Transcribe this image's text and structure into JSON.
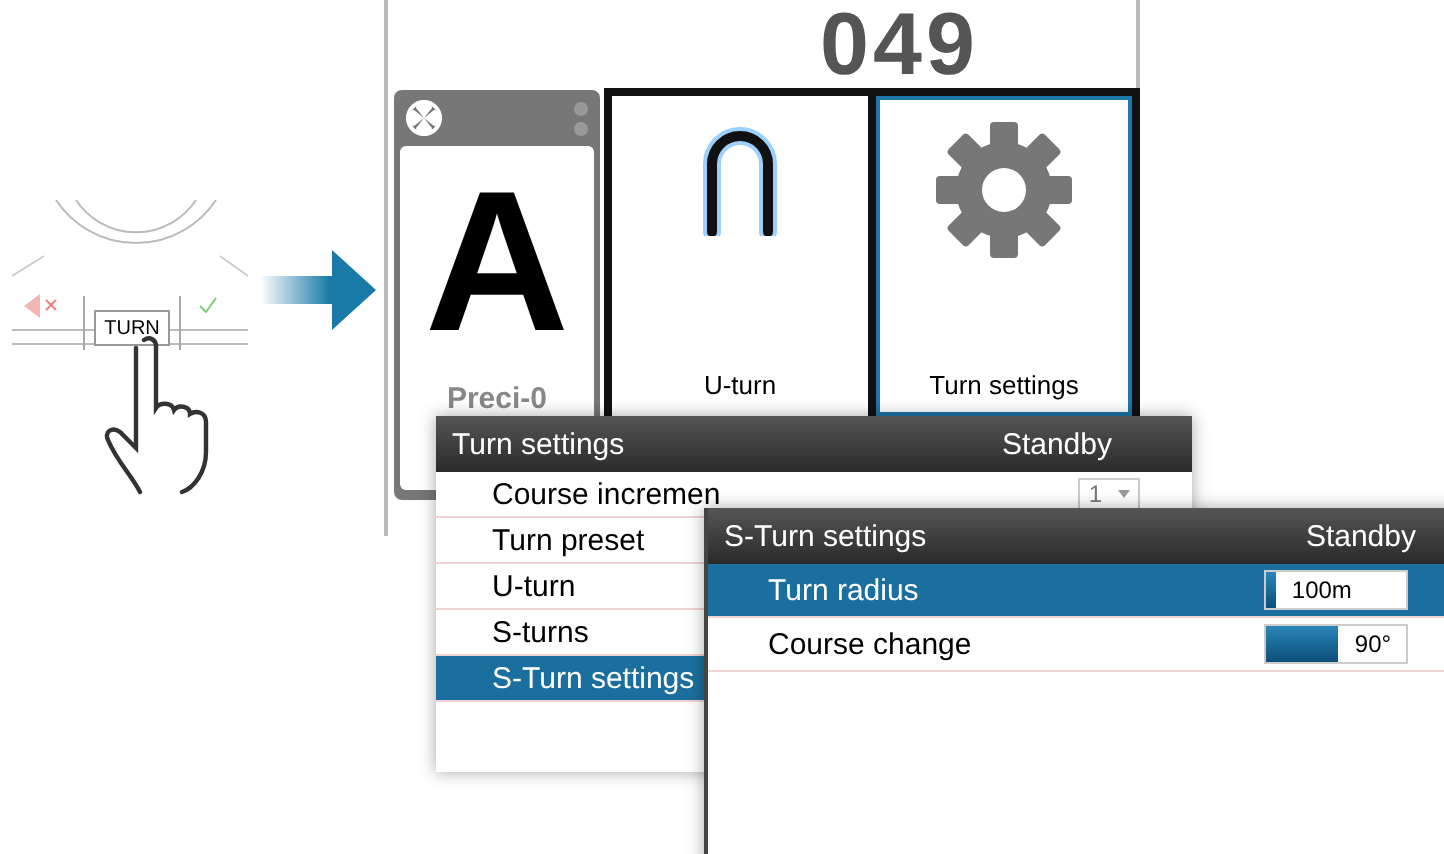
{
  "keypad": {
    "key_label": "TURN"
  },
  "display": {
    "heading": "049",
    "mode_card": {
      "mode": "A",
      "name": "Preci-0"
    },
    "tiles": [
      {
        "label": "U-turn",
        "kind": "uturn",
        "selected": false
      },
      {
        "label": "Turn settings",
        "kind": "gear",
        "selected": true
      }
    ]
  },
  "turn_settings": {
    "title": "Turn settings",
    "status": "Standby",
    "rows": [
      {
        "label": "Course incremen",
        "kind": "dropdown",
        "value": "1",
        "selected": false
      },
      {
        "label": "Turn preset",
        "kind": "plain",
        "selected": false
      },
      {
        "label": "U-turn",
        "kind": "plain",
        "selected": false
      },
      {
        "label": "S-turns",
        "kind": "plain",
        "selected": false
      },
      {
        "label": "S-Turn settings",
        "kind": "plain",
        "selected": true
      }
    ]
  },
  "s_turn_settings": {
    "title": "S-Turn settings",
    "status": "Standby",
    "rows": [
      {
        "label": "Turn radius",
        "value": "100m",
        "level": 0.07,
        "selected": true
      },
      {
        "label": "Course change",
        "value": "90°",
        "level": 0.52,
        "selected": false
      }
    ]
  }
}
